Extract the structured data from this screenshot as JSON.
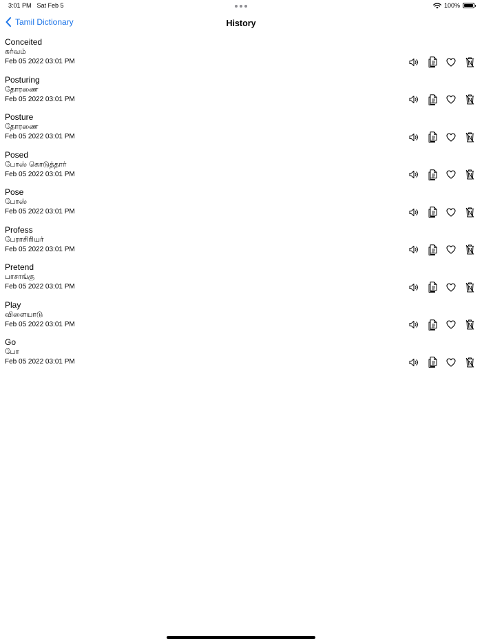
{
  "status_bar": {
    "time": "3:01 PM",
    "date": "Sat Feb 5",
    "battery": "100%"
  },
  "nav": {
    "back_label": "Tamil Dictionary",
    "title": "History"
  },
  "history": [
    {
      "word": "Conceited",
      "translation": "கர்வம்",
      "timestamp": "Feb 05 2022 03:01 PM"
    },
    {
      "word": "Posturing",
      "translation": "தோரணை",
      "timestamp": "Feb 05 2022 03:01 PM"
    },
    {
      "word": "Posture",
      "translation": "தோரணை",
      "timestamp": "Feb 05 2022 03:01 PM"
    },
    {
      "word": "Posed",
      "translation": "போஸ் கொடுத்தார்",
      "timestamp": "Feb 05 2022 03:01 PM"
    },
    {
      "word": "Pose",
      "translation": "போஸ்",
      "timestamp": "Feb 05 2022 03:01 PM"
    },
    {
      "word": "Profess",
      "translation": "பேராசிரியர்",
      "timestamp": "Feb 05 2022 03:01 PM"
    },
    {
      "word": "Pretend",
      "translation": "பாசாங்கு",
      "timestamp": "Feb 05 2022 03:01 PM"
    },
    {
      "word": "Play",
      "translation": "விளையாடு",
      "timestamp": "Feb 05 2022 03:01 PM"
    },
    {
      "word": "Go",
      "translation": "போ",
      "timestamp": "Feb 05 2022 03:01 PM"
    }
  ],
  "icons": {
    "speak": "speaker-icon",
    "copy": "copy-icon",
    "favorite": "heart-icon",
    "delete": "trash-icon"
  },
  "colors": {
    "accent": "#1a73e8",
    "text": "#000000",
    "background": "#ffffff"
  }
}
